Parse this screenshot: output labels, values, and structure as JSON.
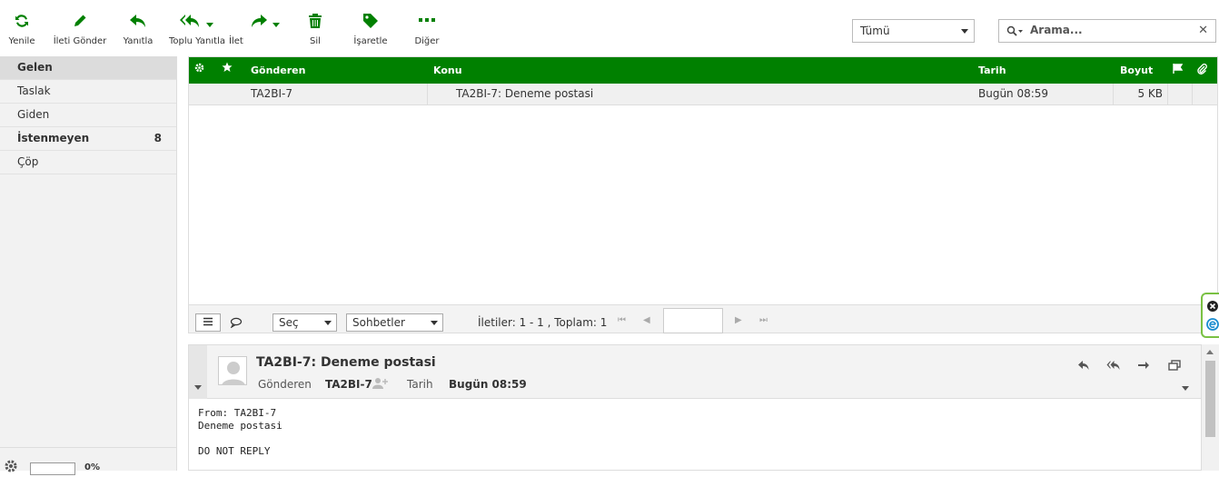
{
  "toolbar": {
    "refresh": "Yenile",
    "compose": "İleti Gönder",
    "reply": "Yanıtla",
    "reply_all": "Toplu Yanıtla",
    "forward": "İlet",
    "delete": "Sil",
    "mark": "İşaretle",
    "more": "Diğer"
  },
  "filter": {
    "selected": "Tümü"
  },
  "search": {
    "placeholder": "Arama..."
  },
  "sidebar": {
    "folders": [
      {
        "label": "Gelen",
        "count": ""
      },
      {
        "label": "Taslak",
        "count": ""
      },
      {
        "label": "Giden",
        "count": ""
      },
      {
        "label": "İstenmeyen",
        "count": "8"
      },
      {
        "label": "Çöp",
        "count": ""
      }
    ],
    "quota": "0%"
  },
  "list": {
    "headers": {
      "from": "Gönderen",
      "subject": "Konu",
      "date": "Tarih",
      "size": "Boyut"
    },
    "rows": [
      {
        "from": "TA2BI-7",
        "subject": "TA2BI-7: Deneme postasi",
        "date": "Bugün 08:59",
        "size": "5 KB"
      }
    ],
    "footer": {
      "select": "Seç",
      "threads": "Sohbetler",
      "count": "İletiler: 1 - 1 , Toplam: 1"
    }
  },
  "preview": {
    "subject": "TA2BI-7: Deneme postasi",
    "from_label": "Gönderen",
    "from_value": "TA2BI-7",
    "date_label": "Tarih",
    "date_value": "Bugün 08:59",
    "body_line1": "From: TA2BI-7",
    "body_line2": "Deneme postasi",
    "body_line3": "DO NOT REPLY"
  },
  "colors": {
    "accent": "#008000"
  }
}
